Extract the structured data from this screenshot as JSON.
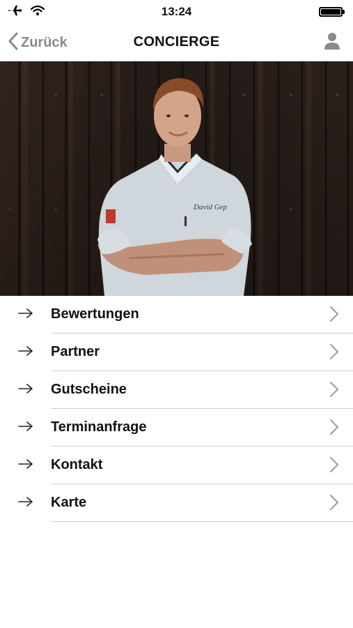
{
  "status_bar": {
    "time": "13:24",
    "icons": [
      "airplane-icon",
      "wifi-icon",
      "battery-icon"
    ]
  },
  "nav": {
    "back_label": "Zurück",
    "title": "CONCIERGE",
    "profile_icon": "user-icon"
  },
  "hero": {
    "image": "chef-portrait-photo",
    "jacket_embroidery": "David Gep"
  },
  "menu": {
    "items": [
      {
        "label": "Bewertungen"
      },
      {
        "label": "Partner"
      },
      {
        "label": "Gutscheine"
      },
      {
        "label": "Terminanfrage"
      },
      {
        "label": "Kontakt"
      },
      {
        "label": "Karte"
      }
    ]
  },
  "colors": {
    "accent_gray": "#8a8a8a",
    "divider": "#d0d0d0",
    "text": "#111111"
  }
}
